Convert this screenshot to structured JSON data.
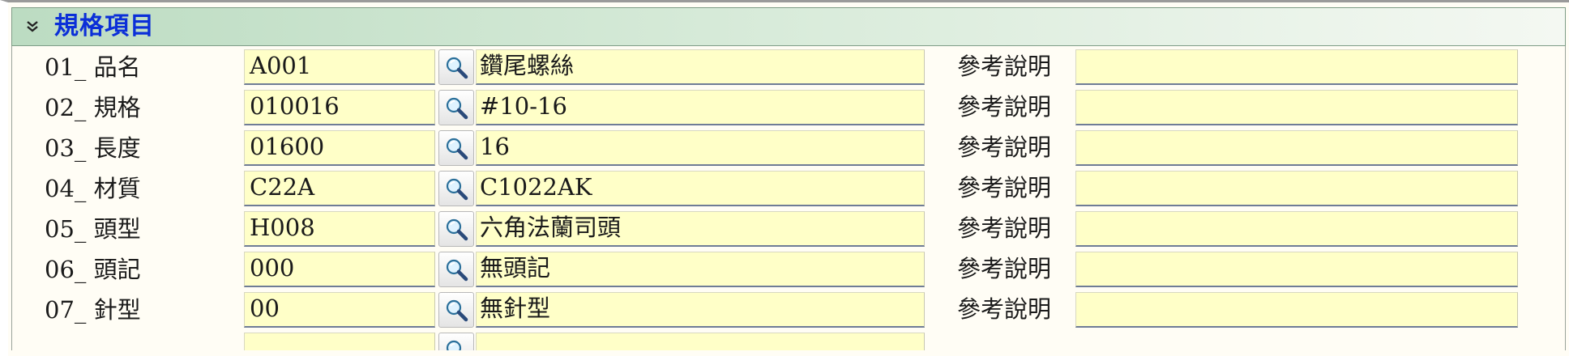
{
  "section": {
    "title": "規格項目",
    "collapse_icon": "double-chevron-down-icon",
    "collapse_glyph": "»"
  },
  "ref_label": "參考說明",
  "lookup_icon": "magnifier-search-icon",
  "rows": [
    {
      "label": "01_ 品名",
      "code": "A001",
      "name": "鑽尾螺絲",
      "ref": ""
    },
    {
      "label": "02_ 規格",
      "code": "010016",
      "name": "#10-16",
      "ref": ""
    },
    {
      "label": "03_ 長度",
      "code": "01600",
      "name": "16",
      "ref": ""
    },
    {
      "label": "04_ 材質",
      "code": "C22A",
      "name": "C1022AK",
      "ref": ""
    },
    {
      "label": "05_ 頭型",
      "code": "H008",
      "name": "六角法蘭司頭",
      "ref": ""
    },
    {
      "label": "06_ 頭記",
      "code": "000",
      "name": "無頭記",
      "ref": ""
    },
    {
      "label": "07_ 針型",
      "code": "00",
      "name": "無針型",
      "ref": ""
    },
    {
      "label": "",
      "code": "",
      "name": "",
      "ref": ""
    }
  ],
  "colors": {
    "field_bg": "#ffffc8",
    "title_blue": "#0b2fd8",
    "header_green": "#bcdcc2"
  }
}
